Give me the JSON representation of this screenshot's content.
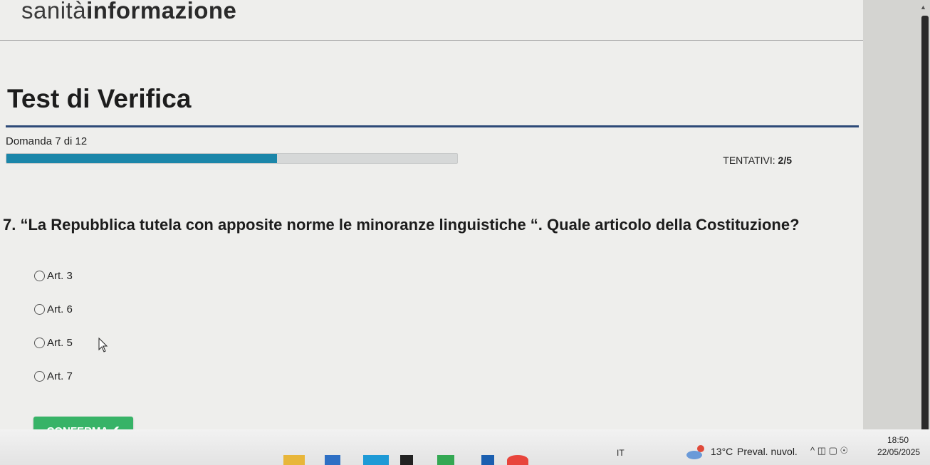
{
  "brand": {
    "light": "sanità",
    "bold": "informazione"
  },
  "test": {
    "title": "Test di Verifica",
    "question_counter": "Domanda 7 di 12",
    "progress": 0.6,
    "attempts_label": "TENTATIVI:",
    "attempts_value": "2/5"
  },
  "question": {
    "text": "7. “La Repubblica tutela con apposite norme le minoranze linguistiche “. Quale articolo della Costituzione?",
    "options": [
      "Art. 3",
      "Art. 6",
      "Art. 5",
      "Art. 7"
    ]
  },
  "confirm_button": {
    "label": "CONFERMA",
    "icon": "✔"
  },
  "taskbar": {
    "language": "IT",
    "temperature": "13°C",
    "weather": "Preval. nuvol.",
    "time": "18:50",
    "date": "22/05/2025"
  },
  "colors": {
    "accent": "#1b86a9",
    "confirm": "#37b367",
    "title_rule": "#2d4a78"
  }
}
